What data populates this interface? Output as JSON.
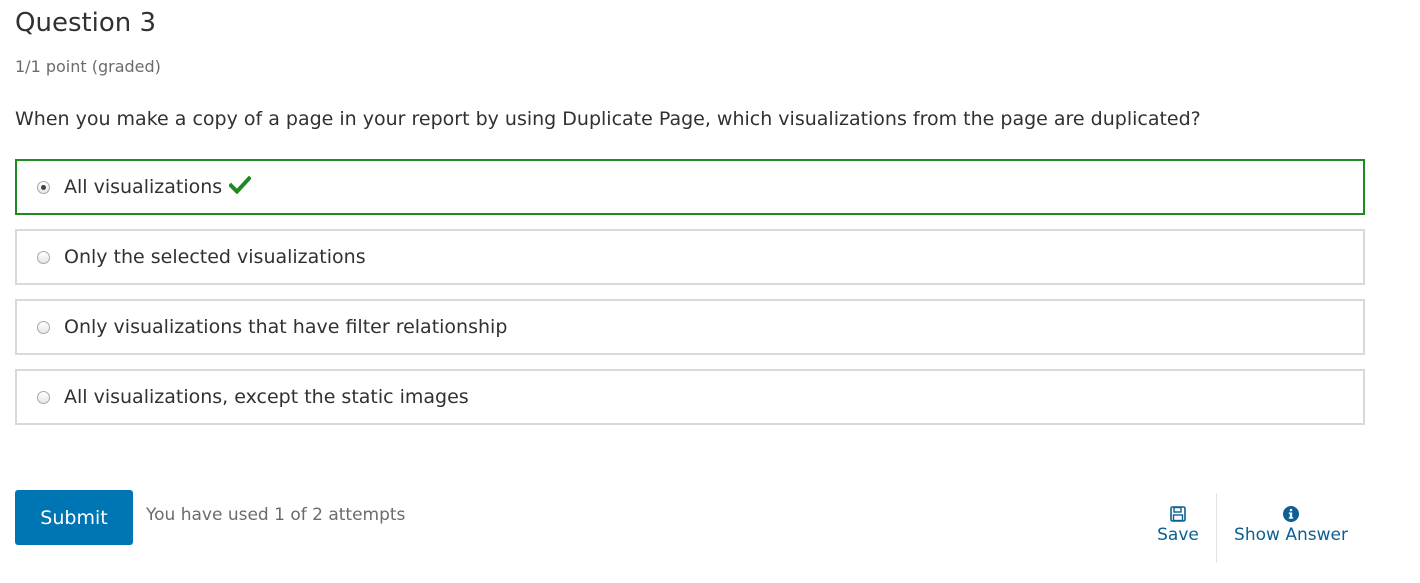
{
  "question": {
    "title": "Question 3",
    "grade": "1/1 point (graded)",
    "prompt": "When you make a copy of a page in your report by using Duplicate Page, which visualizations from the page are duplicated?"
  },
  "choices": [
    {
      "label": "All visualizations",
      "selected": true,
      "correct": true
    },
    {
      "label": "Only the selected visualizations",
      "selected": false
    },
    {
      "label": "Only visualizations that have filter relationship",
      "selected": false
    },
    {
      "label": "All visualizations, except the static images",
      "selected": false
    }
  ],
  "actions": {
    "submit_label": "Submit",
    "attempts_text": "You have used 1 of 2 attempts",
    "save_label": "Save",
    "save_icon": "floppy-disk-icon",
    "show_answer_label": "Show Answer",
    "show_answer_icon": "info-circle-icon"
  },
  "colors": {
    "correct_border": "#1f8a1f",
    "checkmark": "#1f8a1f",
    "submit_bg": "#0075b4",
    "link": "#0b5f92"
  }
}
